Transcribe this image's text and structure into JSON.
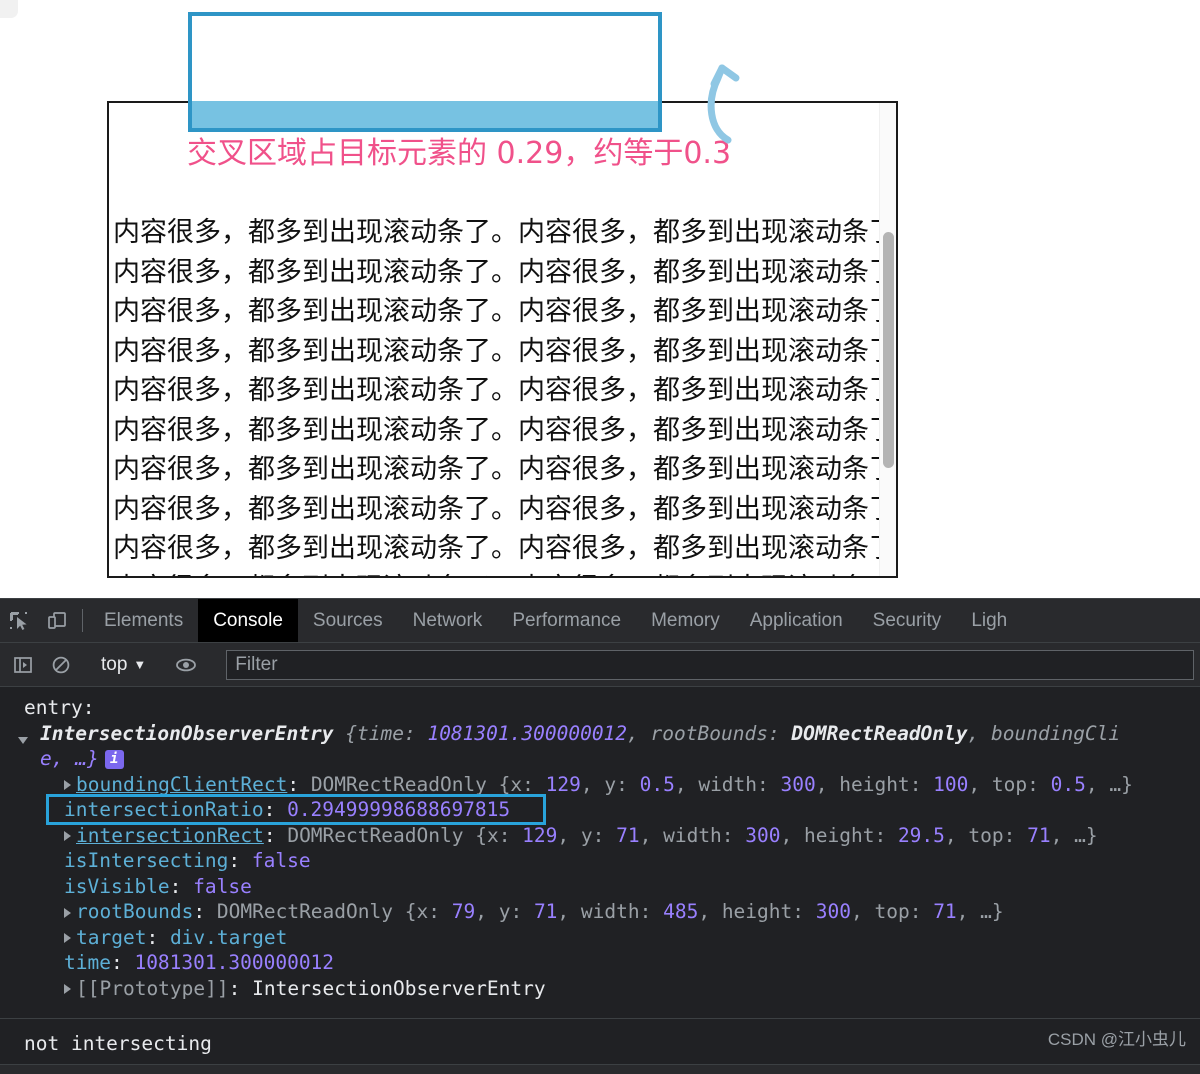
{
  "page": {
    "annotation_note": "交叉区域占目标元素的 0.29，约等于0.3",
    "content_line": "内容很多，都多到出现滚动条了。内容很多，都多到出现滚动条了。",
    "content_line_count": 10,
    "colors": {
      "target_border": "#2e95c6",
      "target_fill": "#77c2e2",
      "note_text": "#f0518a",
      "arrow": "#8fc7e4",
      "root_border": "#1a1a1a"
    }
  },
  "devtools": {
    "toolbar_icons": [
      {
        "name": "inspect-element-icon",
        "title": "Inspect element"
      },
      {
        "name": "device-toolbar-icon",
        "title": "Toggle device toolbar"
      }
    ],
    "tabs": [
      {
        "label": "Elements",
        "active": false
      },
      {
        "label": "Console",
        "active": true
      },
      {
        "label": "Sources",
        "active": false
      },
      {
        "label": "Network",
        "active": false
      },
      {
        "label": "Performance",
        "active": false
      },
      {
        "label": "Memory",
        "active": false
      },
      {
        "label": "Application",
        "active": false
      },
      {
        "label": "Security",
        "active": false
      },
      {
        "label": "Ligh",
        "active": false
      }
    ],
    "console_toolbar": {
      "sidebar_toggle_icon": "console-sidebar-icon",
      "clear_icon": "clear-console-icon",
      "context_label": "top",
      "context_caret": "▼",
      "eye_icon": "live-expression-eye-icon",
      "filter_placeholder": "Filter",
      "filter_value": ""
    },
    "console": {
      "group_label": "entry:",
      "object_name": "IntersectionObserverEntry",
      "object_preview_open": "{",
      "preview": {
        "k_time": "time",
        "v_time": "1081301.300000012",
        "k_rootBounds": "rootBounds",
        "v_rootBounds": "DOMRectReadOnly",
        "k_boundingClientRect": "boundingCli",
        "tail": "e, …}"
      },
      "info_badge": "i",
      "props": {
        "boundingClientRect": {
          "key": "boundingClientRect",
          "type": "DOMRectReadOnly",
          "x": "129",
          "y": "0.5",
          "width": "300",
          "height": "100",
          "top": "0.5"
        },
        "intersectionRatio": {
          "key": "intersectionRatio",
          "value": "0.29499998688697815",
          "highlighted": true
        },
        "intersectionRect": {
          "key": "intersectionRect",
          "type": "DOMRectReadOnly",
          "x": "129",
          "y": "71",
          "width": "300",
          "height": "29.5",
          "top": "71"
        },
        "isIntersecting": {
          "key": "isIntersecting",
          "value": "false"
        },
        "isVisible": {
          "key": "isVisible",
          "value": "false"
        },
        "rootBounds": {
          "key": "rootBounds",
          "type": "DOMRectReadOnly",
          "x": "79",
          "y": "71",
          "width": "485",
          "height": "300",
          "top": "71"
        },
        "target": {
          "key": "target",
          "value": "div.target"
        },
        "time": {
          "key": "time",
          "value": "1081301.300000012"
        },
        "prototype": {
          "key": "[[Prototype]]",
          "value": "IntersectionObserverEntry"
        }
      },
      "labels": {
        "lbl_x": "x",
        "lbl_y": "y",
        "lbl_width": "width",
        "lbl_height": "height",
        "lbl_top": "top",
        "lbl_ellipsis": "…}",
        "colon": ":",
        "comma": ", ",
        "brace_open": "{"
      },
      "final_message": "not intersecting"
    },
    "watermark": "CSDN @江小虫儿"
  }
}
